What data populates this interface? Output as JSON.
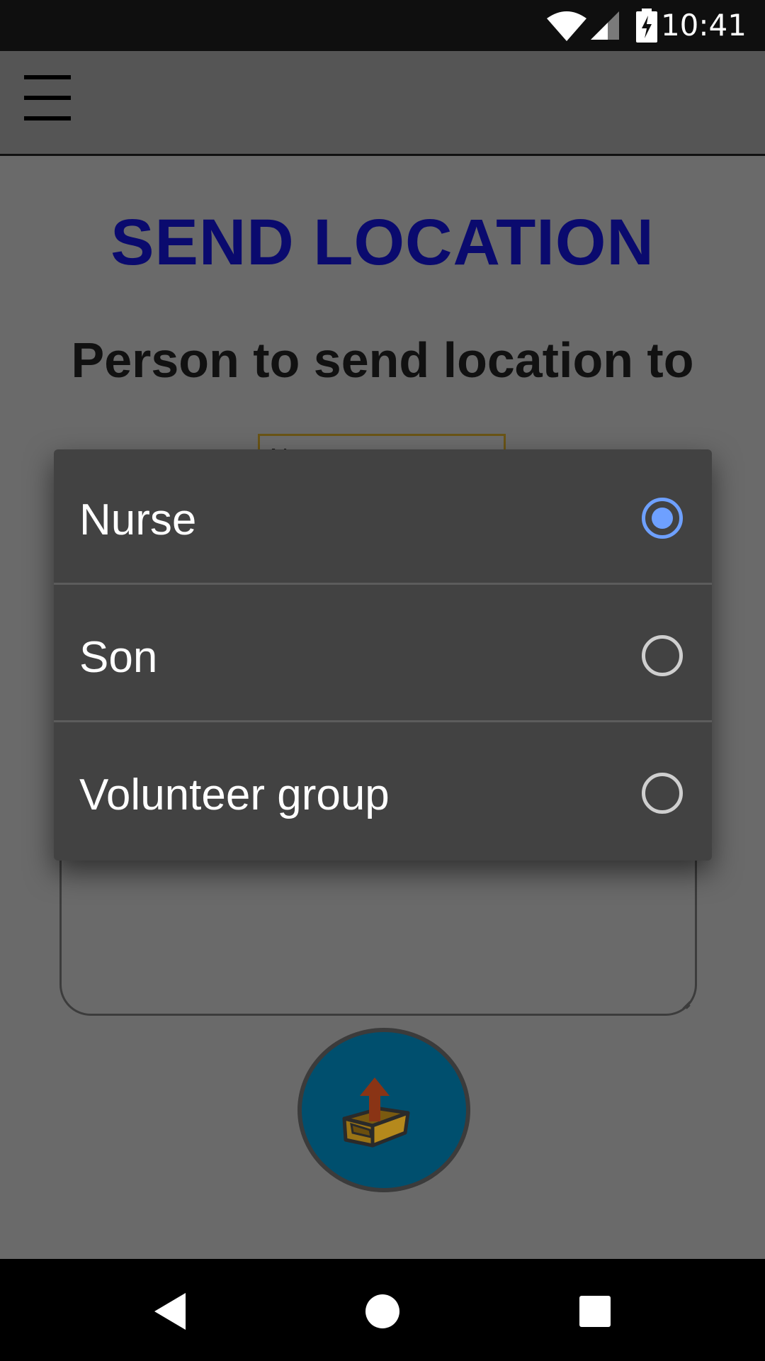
{
  "status_bar": {
    "time": "10:41",
    "icons": [
      "wifi-icon",
      "cell-signal-icon",
      "battery-charging-icon"
    ]
  },
  "app_bar": {
    "menu_icon": "hamburger-menu-icon"
  },
  "main": {
    "title": "SEND LOCATION",
    "subheading": "Person to send location to",
    "selected_recipient": "Nurse",
    "send_button_icon": "outbox-upload-icon"
  },
  "dialog": {
    "options": [
      {
        "label": "Nurse",
        "selected": true
      },
      {
        "label": "Son",
        "selected": false
      },
      {
        "label": "Volunteer group",
        "selected": false
      }
    ]
  },
  "nav_bar": {
    "icons": [
      "back-icon",
      "home-icon",
      "recents-icon"
    ]
  },
  "colors": {
    "title": "#0a0a6e",
    "radio_selected": "#6ea0ff",
    "dialog_bg": "#424242",
    "send_button": "#004f6e",
    "scrim_bg": "#6a6a6a"
  }
}
